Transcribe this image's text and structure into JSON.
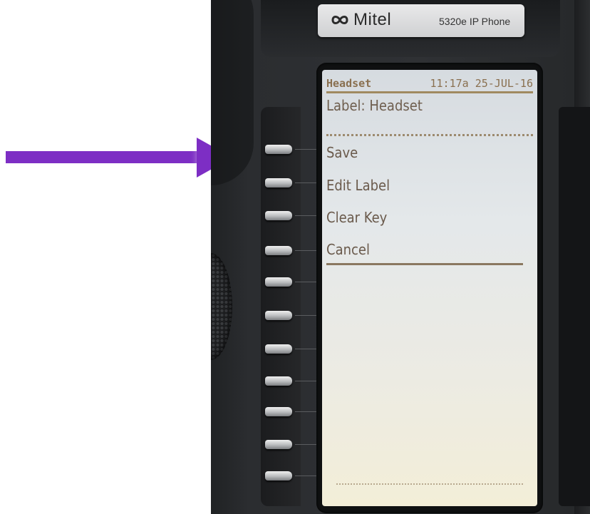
{
  "annotation": {
    "arrow_color": "#7d2ec4",
    "points_to": "save-key"
  },
  "device": {
    "brand": "Mitel",
    "model": "5320e IP Phone",
    "logo_icon": "mitel-infinity-icon"
  },
  "screen": {
    "title": "Headset",
    "datetime": "11:17a 25-JUL-16",
    "label_line": "Label: Headset",
    "menu": [
      {
        "label": "Save"
      },
      {
        "label": "Edit Label"
      },
      {
        "label": "Clear Key"
      },
      {
        "label": "Cancel"
      }
    ]
  },
  "colors": {
    "screen_text": "#6b5a4a",
    "header_text": "#8a7050",
    "phone_body": "#2b2d30"
  }
}
